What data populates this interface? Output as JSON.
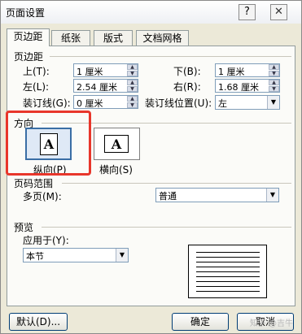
{
  "window": {
    "title": "页面设置",
    "help_glyph": "?",
    "close_glyph": "✕"
  },
  "tabs": [
    "页边距",
    "纸张",
    "版式",
    "文档网格"
  ],
  "margins": {
    "section_label": "页边距",
    "top_label": "上(T):",
    "top_value": "1 厘米",
    "bottom_label": "下(B):",
    "bottom_value": "1 厘米",
    "left_label": "左(L):",
    "left_value": "2.54 厘米",
    "right_label": "右(R):",
    "right_value": "1.68 厘米",
    "gutter_label": "装订线(G):",
    "gutter_value": "0 厘米",
    "gutter_pos_label": "装订线位置(U):",
    "gutter_pos_value": "左"
  },
  "orientation": {
    "section_label": "方向",
    "portrait_label": "纵向(P)",
    "landscape_label": "横向(S)",
    "icon_glyph": "A",
    "selected": "portrait"
  },
  "pages": {
    "section_label": "页码范围",
    "multiple_label": "多页(M):",
    "multiple_value": "普通"
  },
  "preview": {
    "section_label": "预览",
    "apply_label": "应用于(Y):",
    "apply_value": "本节"
  },
  "footer": {
    "default_button": "默认(D)...",
    "ok_button": "确定",
    "cancel_button": "取消"
  },
  "watermark": "知乎 @吉牛",
  "colors": {
    "highlight": "#e8362b",
    "selection": "#3a6ea5"
  },
  "icons": {
    "spin_up": "▲",
    "spin_down": "▼",
    "combo_drop": "▼"
  }
}
